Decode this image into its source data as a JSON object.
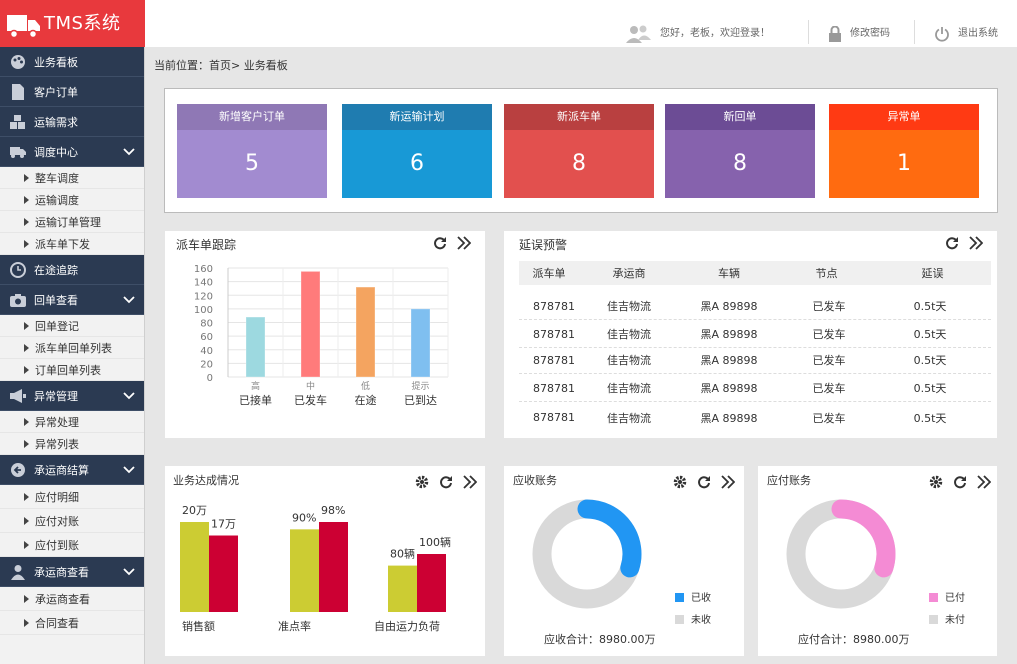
{
  "app": {
    "title": "TMS系统"
  },
  "topbar": {
    "greeting": "您好，老板，欢迎登录！",
    "change_password": "修改密码",
    "logout": "退出系统"
  },
  "breadcrumb": {
    "text": "当前位置：首页>  业务看板"
  },
  "sidebar": {
    "items": [
      {
        "label": "业务看板",
        "icon": "palette-icon"
      },
      {
        "label": "客户订单",
        "icon": "document-icon"
      },
      {
        "label": "运输需求",
        "icon": "boxes-icon"
      },
      {
        "label": "调度中心",
        "icon": "truck-icon",
        "expandable": true
      },
      {
        "label": "整车调度"
      },
      {
        "label": "运输调度"
      },
      {
        "label": "运输订单管理"
      },
      {
        "label": "派车单下发"
      },
      {
        "label": "在途追踪",
        "icon": "clock-icon"
      },
      {
        "label": "回单查看",
        "icon": "camera-icon",
        "expandable": true
      },
      {
        "label": "回单登记"
      },
      {
        "label": "派车单回单列表"
      },
      {
        "label": "订单回单列表"
      },
      {
        "label": "异常管理",
        "icon": "megaphone-icon",
        "expandable": true
      },
      {
        "label": "异常处理"
      },
      {
        "label": "异常列表"
      },
      {
        "label": "承运商结算",
        "icon": "arrow-circle-icon",
        "expandable": true
      },
      {
        "label": "应付明细"
      },
      {
        "label": "应付对账"
      },
      {
        "label": "应付到账"
      },
      {
        "label": "承运商查看",
        "icon": "person-icon",
        "expandable": true
      },
      {
        "label": "承运商查看"
      },
      {
        "label": "合同查看"
      }
    ]
  },
  "stats": [
    {
      "label": "新增客户订单",
      "value": "5",
      "head": "#8f78b5",
      "body": "#a28bd0"
    },
    {
      "label": "新运输计划",
      "value": "6",
      "head": "#1f7cb0",
      "body": "#1899d6"
    },
    {
      "label": "新派车单",
      "value": "8",
      "head": "#b94040",
      "body": "#e2504e"
    },
    {
      "label": "新回单",
      "value": "8",
      "head": "#6c4c95",
      "body": "#8662ad"
    },
    {
      "label": "异常单",
      "value": "1",
      "head": "#ff3a13",
      "body": "#ff6b10"
    }
  ],
  "dispatch_panel": {
    "title": "派车单跟踪"
  },
  "delay_panel": {
    "title": "延误预警",
    "columns": [
      "派车单",
      "承运商",
      "车辆",
      "节点",
      "延误"
    ],
    "rows": [
      [
        "878781",
        "佳吉物流",
        "黑A 89898",
        "已发车",
        "0.5t天"
      ],
      [
        "878781",
        "佳吉物流",
        "黑A 89898",
        "已发车",
        "0.5t天"
      ],
      [
        "878781",
        "佳吉物流",
        "黑A 89898",
        "已发车",
        "0.5t天"
      ],
      [
        "878781",
        "佳吉物流",
        "黑A 89898",
        "已发车",
        "0.5t天"
      ],
      [
        "878781",
        "佳吉物流",
        "黑A 89898",
        "已发车",
        "0.5t天"
      ]
    ]
  },
  "business_panel": {
    "title": "业务达成情况"
  },
  "receivable_panel": {
    "title": "应收账务",
    "legend": [
      "已收",
      "未收"
    ],
    "total": "应收合计：8980.00万",
    "colors": [
      "#2196f3",
      "#d9d9d9"
    ]
  },
  "payable_panel": {
    "title": "应付账务",
    "legend": [
      "已付",
      "未付"
    ],
    "total": "应付合计：8980.00万",
    "colors": [
      "#f48bd4",
      "#d9d9d9"
    ]
  },
  "chart_data": [
    {
      "type": "bar",
      "categories": [
        "高",
        "中",
        "低",
        "提示"
      ],
      "category_labels": [
        "已接单",
        "已发车",
        "在途",
        "已到达"
      ],
      "values": [
        88,
        155,
        132,
        100
      ],
      "colors": [
        "#9dd9e0",
        "#ff7b7b",
        "#f4a460",
        "#7fbff0"
      ],
      "yticks": [
        0,
        20,
        40,
        60,
        80,
        100,
        120,
        140,
        160
      ],
      "ylim": [
        0,
        160
      ],
      "grid": true
    },
    {
      "type": "bar",
      "groups": [
        {
          "label": "销售额",
          "values": [
            20,
            17
          ],
          "value_labels": [
            "20万",
            "17万"
          ]
        },
        {
          "label": "准点率",
          "values": [
            90,
            98
          ],
          "value_labels": [
            "90%",
            "98%"
          ]
        },
        {
          "label": "自由运力负荷",
          "values": [
            80,
            100
          ],
          "value_labels": [
            "80辆",
            "100辆"
          ]
        }
      ],
      "colors": [
        "#cccc33",
        "#cc0033"
      ]
    },
    {
      "type": "pie",
      "labels": [
        "已收",
        "未收"
      ],
      "values": [
        30,
        70
      ]
    },
    {
      "type": "pie",
      "labels": [
        "已付",
        "未付"
      ],
      "values": [
        30,
        70
      ]
    }
  ]
}
